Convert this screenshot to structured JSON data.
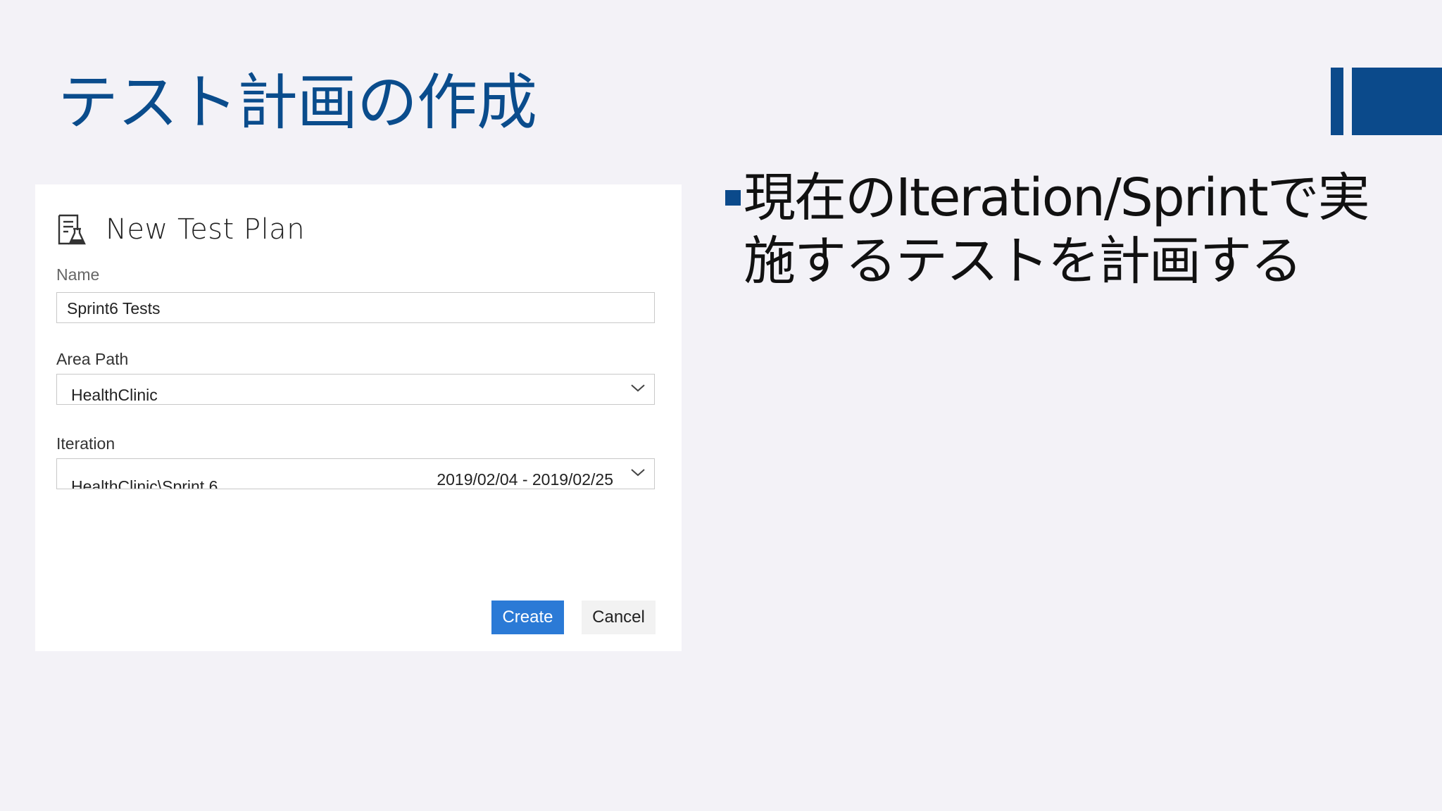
{
  "slide": {
    "title": "テスト計画の作成",
    "bullet": "現在のIteration/Sprintで実施するテストを計画する",
    "accent_color": "#0b4a8b"
  },
  "dialog": {
    "title": "New Test Plan",
    "icon": "test-plan-icon",
    "name": {
      "label": "Name",
      "value": "Sprint6 Tests"
    },
    "area_path": {
      "label": "Area Path",
      "value": "HealthClinic"
    },
    "iteration": {
      "label": "Iteration",
      "value": "HealthClinic\\Sprint 6",
      "dates": "2019/02/04 - 2019/02/25"
    },
    "buttons": {
      "create": "Create",
      "cancel": "Cancel"
    },
    "primary_color": "#2b7ad6"
  }
}
